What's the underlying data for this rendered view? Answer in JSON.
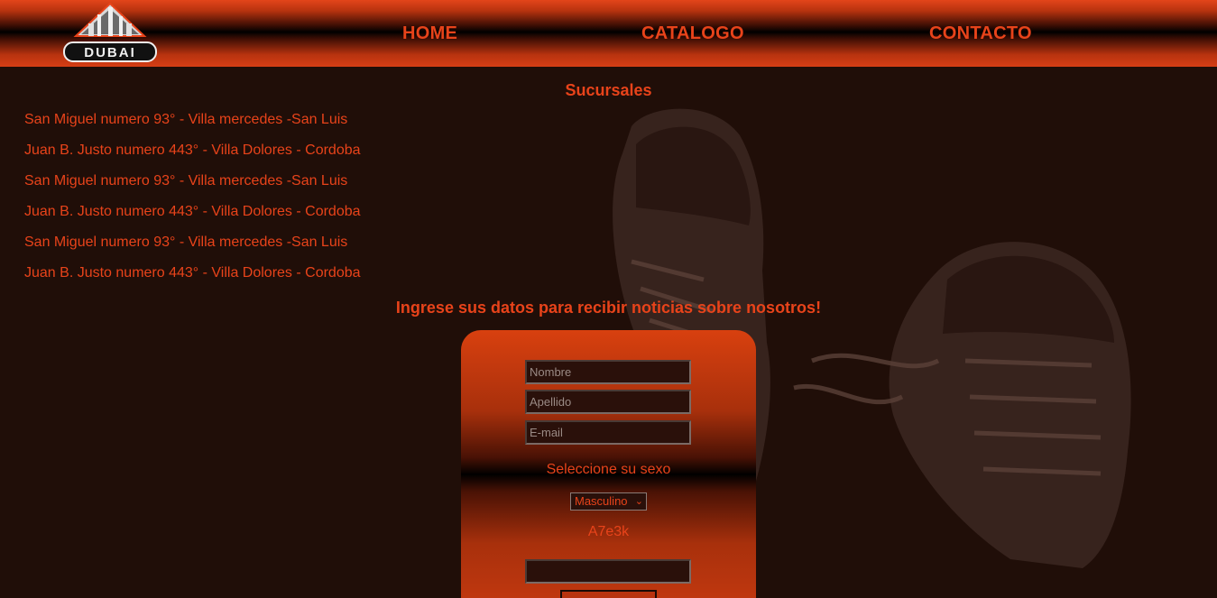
{
  "header": {
    "logo_text": "DUBAI",
    "nav": [
      {
        "label": "HOME"
      },
      {
        "label": "CATALOGO"
      },
      {
        "label": "CONTACTO"
      }
    ]
  },
  "branches": {
    "title": "Sucursales",
    "items": [
      "San Miguel numero 93° - Villa mercedes -San Luis",
      "Juan B. Justo numero 443° - Villa Dolores - Cordoba",
      "San Miguel numero 93° - Villa mercedes -San Luis",
      "Juan B. Justo numero 443° - Villa Dolores - Cordoba",
      "San Miguel numero 93° - Villa mercedes -San Luis",
      "Juan B. Justo numero 443° - Villa Dolores - Cordoba"
    ]
  },
  "newsletter": {
    "title": "Ingrese sus datos para recibir noticias sobre nosotros!",
    "first_name_placeholder": "Nombre",
    "last_name_placeholder": "Apellido",
    "email_placeholder": "E-mail",
    "sex_label": "Seleccione su sexo",
    "sex_selected": "Masculino",
    "captcha_code": "A7e3k",
    "captcha_input_value": ""
  },
  "colors": {
    "accent": "#e8431a",
    "background": "#200e08",
    "header_dark": "#000000"
  }
}
